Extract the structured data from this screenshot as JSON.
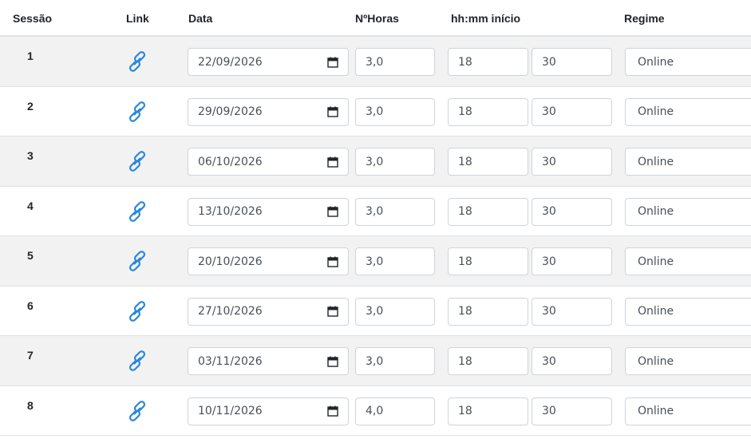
{
  "headers": {
    "sessao": "Sessão",
    "link": "Link",
    "data": "Data",
    "horas": "NºHoras",
    "inicio": "hh:mm início",
    "regime": "Regime"
  },
  "icons": {
    "link": "link-icon",
    "calendar": "calendar-icon"
  },
  "colors": {
    "link_icon": "#2b87d9",
    "stripe": "#f2f2f2"
  },
  "rows": [
    {
      "sessao": "1",
      "data": "22/09/2026",
      "horas": "3,0",
      "hh": "18",
      "mm": "30",
      "regime": "Online"
    },
    {
      "sessao": "2",
      "data": "29/09/2026",
      "horas": "3,0",
      "hh": "18",
      "mm": "30",
      "regime": "Online"
    },
    {
      "sessao": "3",
      "data": "06/10/2026",
      "horas": "3,0",
      "hh": "18",
      "mm": "30",
      "regime": "Online"
    },
    {
      "sessao": "4",
      "data": "13/10/2026",
      "horas": "3,0",
      "hh": "18",
      "mm": "30",
      "regime": "Online"
    },
    {
      "sessao": "5",
      "data": "20/10/2026",
      "horas": "3,0",
      "hh": "18",
      "mm": "30",
      "regime": "Online"
    },
    {
      "sessao": "6",
      "data": "27/10/2026",
      "horas": "3,0",
      "hh": "18",
      "mm": "30",
      "regime": "Online"
    },
    {
      "sessao": "7",
      "data": "03/11/2026",
      "horas": "3,0",
      "hh": "18",
      "mm": "30",
      "regime": "Online"
    },
    {
      "sessao": "8",
      "data": "10/11/2026",
      "horas": "4,0",
      "hh": "18",
      "mm": "30",
      "regime": "Online"
    }
  ]
}
